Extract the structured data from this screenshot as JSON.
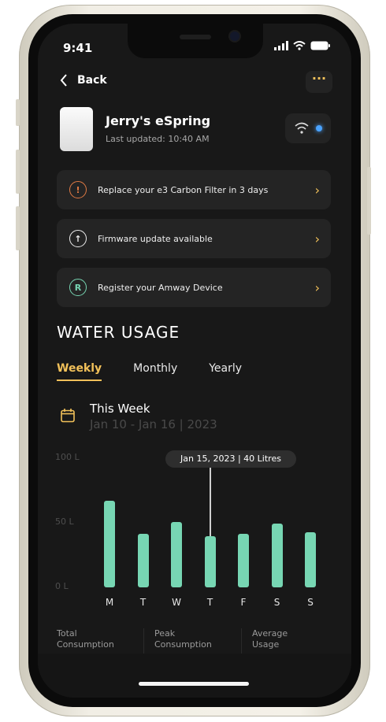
{
  "status": {
    "time": "9:41"
  },
  "nav": {
    "back_label": "Back",
    "more_label": "···"
  },
  "device": {
    "name": "Jerry's eSpring",
    "last_updated": "Last updated: 10:40 AM"
  },
  "alerts": [
    {
      "icon": "warning-circle-icon",
      "label": "Replace your e3 Carbon Filter in 3 days",
      "color": "#e07a44"
    },
    {
      "icon": "upload-circle-icon",
      "label": "Firmware update available",
      "color": "#eeeeee"
    },
    {
      "icon": "register-circle-icon",
      "label": "Register your Amway Device",
      "color": "#77d6b3"
    }
  ],
  "usage": {
    "section_title": "WATER USAGE",
    "tabs": [
      "Weekly",
      "Monthly",
      "Yearly"
    ],
    "active_tab": "Weekly",
    "week_title": "This Week",
    "week_range": "Jan 10 - Jan 16 | 2023",
    "tooltip": "Jan 15, 2023 | 40 Litres"
  },
  "chart_data": {
    "type": "bar",
    "categories": [
      "M",
      "T",
      "W",
      "T",
      "F",
      "S",
      "S"
    ],
    "values": [
      66,
      41,
      50,
      39,
      41,
      49,
      42
    ],
    "ylim": [
      0,
      100
    ],
    "yticks": [
      "100 L",
      "50 L",
      "0 L"
    ],
    "highlight_index": 3,
    "bar_color": "#77d6b3"
  },
  "stats": [
    {
      "line1": "Total",
      "line2": "Consumption"
    },
    {
      "line1": "Peak",
      "line2": "Consumption"
    },
    {
      "line1": "Average",
      "line2": "Usage"
    }
  ],
  "colors": {
    "accent": "#f2c15a",
    "bar": "#77d6b3",
    "wifi": "#4aa3ff"
  }
}
